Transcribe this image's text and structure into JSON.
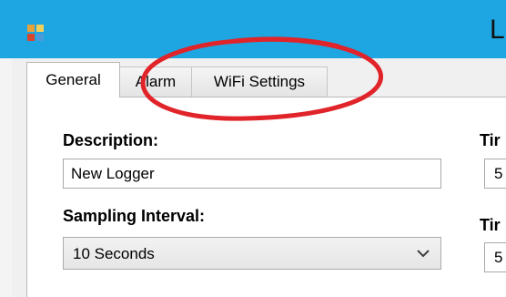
{
  "window": {
    "title": "L"
  },
  "tabs": [
    {
      "label": "General",
      "active": true
    },
    {
      "label": "Alarm",
      "active": false
    },
    {
      "label": "WiFi Settings",
      "active": false
    }
  ],
  "general": {
    "description_label": "Description:",
    "description_value": "New Logger",
    "sampling_label": "Sampling Interval:",
    "sampling_value": "10 Seconds",
    "right_label_1": "Tir",
    "right_value_1": "5",
    "right_label_2": "Tir",
    "right_value_2": "5"
  },
  "annotation": {
    "color": "#e0242a"
  },
  "colors": {
    "titlebar": "#1ea6e2"
  }
}
